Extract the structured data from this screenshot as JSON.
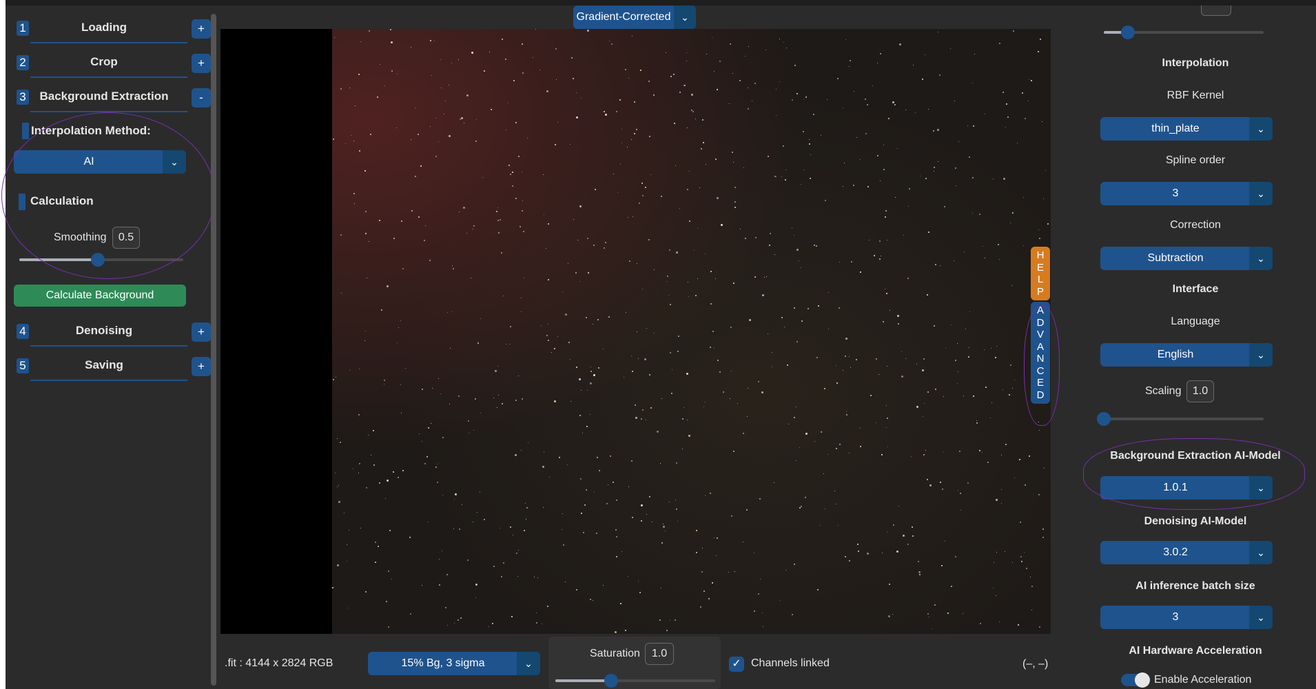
{
  "colors": {
    "accent": "#1f538d",
    "green": "#2e8b57",
    "help": "#d77b1f",
    "annotation": "#7a2fb0"
  },
  "steps": [
    {
      "num": "1",
      "title": "Loading",
      "button": "+"
    },
    {
      "num": "2",
      "title": "Crop",
      "button": "+"
    },
    {
      "num": "3",
      "title": "Background Extraction",
      "button": "-"
    },
    {
      "num": "4",
      "title": "Denoising",
      "button": "+"
    },
    {
      "num": "5",
      "title": "Saving",
      "button": "+"
    }
  ],
  "bg_extraction": {
    "interpolation_label": "Interpolation Method:",
    "method_value": "AI",
    "calculation_label": "Calculation",
    "smoothing_label": "Smoothing",
    "smoothing_value": "0.5",
    "smoothing_fraction": 0.48,
    "calculate_button": "Calculate Background"
  },
  "viewer": {
    "display_mode": "Gradient-Corrected"
  },
  "side_tabs": {
    "help": [
      "H",
      "E",
      "L",
      "P"
    ],
    "advanced": [
      "A",
      "D",
      "V",
      "A",
      "N",
      "C",
      "E",
      "D"
    ]
  },
  "advanced": {
    "top_slider_fraction": 0.15,
    "interpolation_title": "Interpolation",
    "rbf_kernel_label": "RBF Kernel",
    "rbf_kernel_value": "thin_plate",
    "spline_order_label": "Spline order",
    "spline_order_value": "3",
    "correction_label": "Correction",
    "correction_value": "Subtraction",
    "interface_title": "Interface",
    "language_label": "Language",
    "language_value": "English",
    "scaling_label": "Scaling",
    "scaling_value": "1.0",
    "scaling_fraction": 0.0,
    "bg_model_title": "Background Extraction AI-Model",
    "bg_model_value": "1.0.1",
    "denoise_model_title": "Denoising AI-Model",
    "denoise_model_value": "3.0.2",
    "batch_title": "AI inference batch size",
    "batch_value": "3",
    "hw_title": "AI Hardware Acceleration",
    "hw_toggle_label": "Enable Acceleration"
  },
  "bottom": {
    "file_info": ".fit : 4144 x 2824 RGB",
    "stretch_value": "15% Bg, 3 sigma",
    "saturation_label": "Saturation",
    "saturation_value": "1.0",
    "saturation_fraction": 0.35,
    "channels_label": "Channels linked",
    "coords": "(–, –)"
  },
  "icons": {
    "chevron": "chevron-down-icon",
    "check": "check-icon"
  }
}
